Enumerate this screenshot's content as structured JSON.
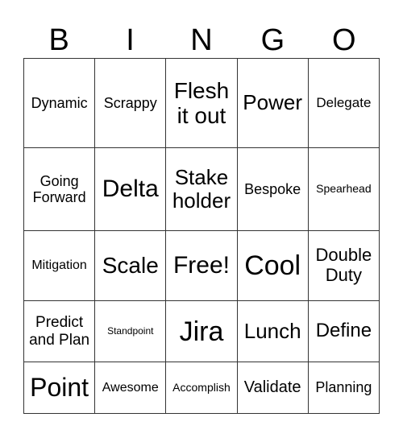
{
  "header": [
    "B",
    "I",
    "N",
    "G",
    "O"
  ],
  "cells": [
    [
      {
        "t": "Dynamic",
        "s": 18
      },
      {
        "t": "Scrappy",
        "s": 18
      },
      {
        "t": "Flesh it out",
        "s": 28
      },
      {
        "t": "Power",
        "s": 26
      },
      {
        "t": "Delegate",
        "s": 17
      }
    ],
    [
      {
        "t": "Going Forward",
        "s": 18
      },
      {
        "t": "Delta",
        "s": 30
      },
      {
        "t": "Stake holder",
        "s": 26
      },
      {
        "t": "Bespoke",
        "s": 18
      },
      {
        "t": "Spearhead",
        "s": 14
      }
    ],
    [
      {
        "t": "Mitigation",
        "s": 16
      },
      {
        "t": "Scale",
        "s": 28
      },
      {
        "t": "Free!",
        "s": 30
      },
      {
        "t": "Cool",
        "s": 34
      },
      {
        "t": "Double Duty",
        "s": 22
      }
    ],
    [
      {
        "t": "Predict and Plan",
        "s": 19
      },
      {
        "t": "Standpoint",
        "s": 12
      },
      {
        "t": "Jira",
        "s": 34
      },
      {
        "t": "Lunch",
        "s": 26
      },
      {
        "t": "Define",
        "s": 24
      }
    ],
    [
      {
        "t": "Point",
        "s": 32
      },
      {
        "t": "Awesome",
        "s": 16
      },
      {
        "t": "Accomplish",
        "s": 14
      },
      {
        "t": "Validate",
        "s": 20
      },
      {
        "t": "Planning",
        "s": 18
      }
    ]
  ]
}
